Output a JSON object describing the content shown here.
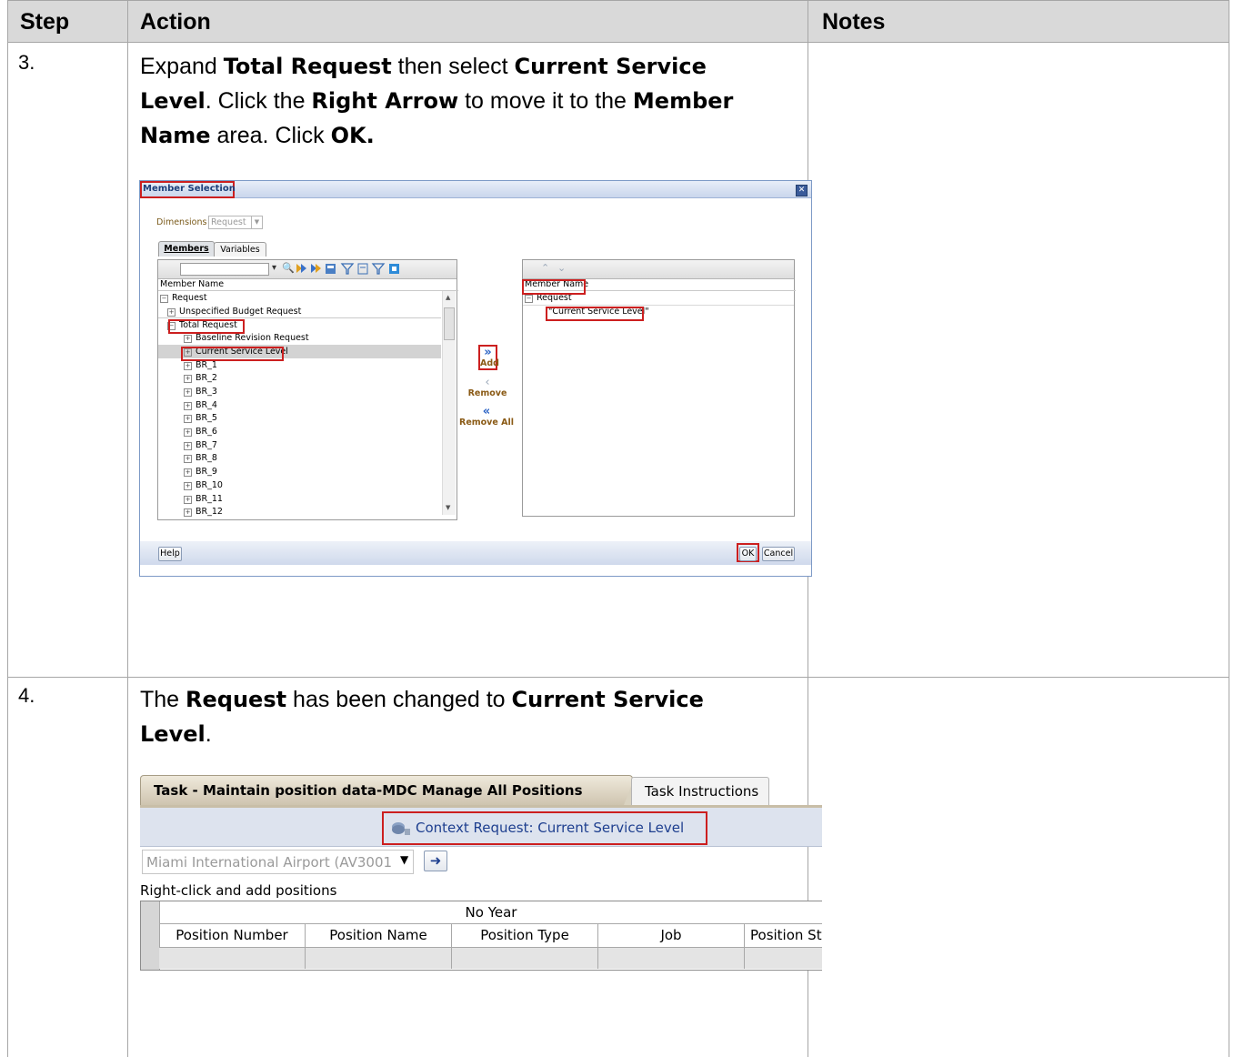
{
  "table": {
    "headers": [
      "Step",
      "Action",
      "Notes"
    ]
  },
  "step3": {
    "number": "3.",
    "text_parts": [
      {
        "t": "Expand ",
        "b": false
      },
      {
        "t": "Total Request",
        "b": true
      },
      {
        "t": " then select ",
        "b": false
      },
      {
        "t": "Current Service Level",
        "b": true
      },
      {
        "t": ". Click the ",
        "b": false
      },
      {
        "t": "Right Arrow",
        "b": true
      },
      {
        "t": " to move it to the ",
        "b": false
      },
      {
        "t": "Member Name",
        "b": true
      },
      {
        "t": " area. Click ",
        "b": false
      },
      {
        "t": "OK.",
        "b": true
      }
    ],
    "lines": [
      [
        "Expand ",
        "Total Request",
        " then select ",
        "Current Service"
      ],
      [
        "Level",
        ". Click the ",
        "Right Arrow",
        " to move it to the ",
        "Member"
      ],
      [
        "Name",
        " area. Click ",
        "OK."
      ]
    ]
  },
  "dialog": {
    "title": "Member Selection",
    "dimensions_label": "Dimensions",
    "dimensions_value": "Request",
    "tabs": [
      "Members",
      "Variables"
    ],
    "left_header": "Member Name",
    "left_tree": [
      {
        "label": "Request",
        "indent": 0,
        "sign": "-"
      },
      {
        "label": "Unspecified Budget Request",
        "indent": 1,
        "sign": "+"
      },
      {
        "label": "Total Request",
        "indent": 1,
        "sign": "-"
      },
      {
        "label": "Baseline Revision Request",
        "indent": 2,
        "sign": "+"
      },
      {
        "label": "Current Service Level",
        "indent": 2,
        "sign": "+"
      },
      {
        "label": "BR_1",
        "indent": 2,
        "sign": "+"
      },
      {
        "label": "BR_2",
        "indent": 2,
        "sign": "+"
      },
      {
        "label": "BR_3",
        "indent": 2,
        "sign": "+"
      },
      {
        "label": "BR_4",
        "indent": 2,
        "sign": "+"
      },
      {
        "label": "BR_5",
        "indent": 2,
        "sign": "+"
      },
      {
        "label": "BR_6",
        "indent": 2,
        "sign": "+"
      },
      {
        "label": "BR_7",
        "indent": 2,
        "sign": "+"
      },
      {
        "label": "BR_8",
        "indent": 2,
        "sign": "+"
      },
      {
        "label": "BR_9",
        "indent": 2,
        "sign": "+"
      },
      {
        "label": "BR_10",
        "indent": 2,
        "sign": "+"
      },
      {
        "label": "BR_11",
        "indent": 2,
        "sign": "+"
      },
      {
        "label": "BR_12",
        "indent": 2,
        "sign": "+"
      }
    ],
    "add_label": "Add",
    "remove_label": "Remove",
    "remove_all_label": "Remove All",
    "right_header": "Member Name",
    "right_tree": [
      {
        "label": "Request",
        "sign": "-"
      },
      {
        "label": "\"Current Service Level\"",
        "sign": ""
      }
    ],
    "help_label": "Help",
    "ok_label": "OK",
    "cancel_label": "Cancel"
  },
  "step4": {
    "number": "4.",
    "line1": [
      "The ",
      "Request",
      " has been changed to ",
      "Current Service"
    ],
    "line2": [
      "Level",
      "."
    ]
  },
  "task": {
    "active_tab": "Task - Maintain position data-MDC Manage All Positions",
    "other_tab": "Task Instructions",
    "context": "Context Request: Current Service Level",
    "entity": "Miami International Airport (AV3001",
    "hint": "Right-click and add positions",
    "group_header": "No Year",
    "columns": [
      "Position Number",
      "Position Name",
      "Position Type",
      "Job",
      "Position St"
    ]
  },
  "colors": {
    "header_gray": "#d9d9d9",
    "highlight_red": "#cc1f1f",
    "dialog_border": "#7d9ac6"
  }
}
